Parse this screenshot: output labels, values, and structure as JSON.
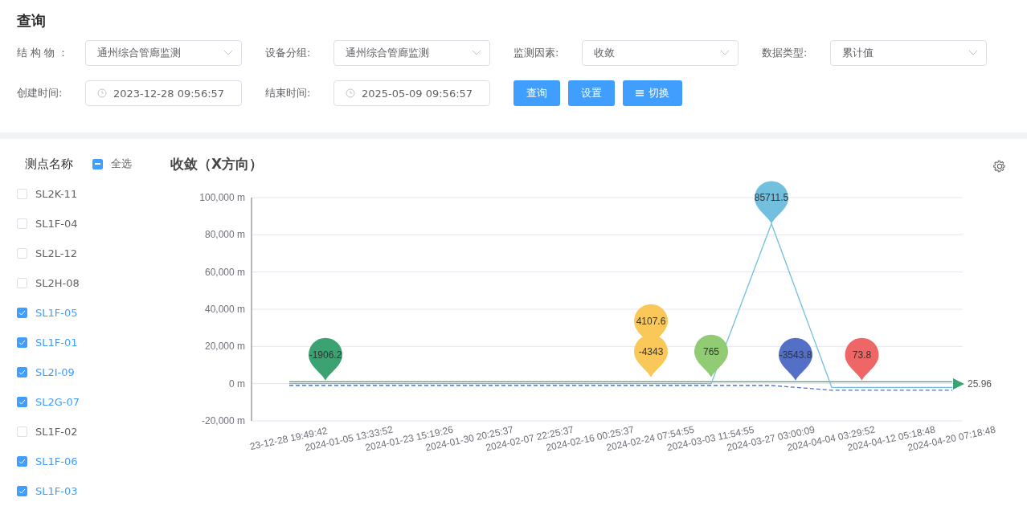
{
  "query_panel": {
    "title": "查询",
    "filters": [
      {
        "label": "结 构 物 ：",
        "kind": "select",
        "value": "通州综合管廊监测"
      },
      {
        "label": "设备分组:",
        "kind": "select",
        "value": "通州综合管廊监测"
      },
      {
        "label": "监测因素:",
        "kind": "select",
        "value": "收敛"
      },
      {
        "label": "数据类型:",
        "kind": "select",
        "value": "累计值"
      },
      {
        "label": "创建时间:",
        "kind": "date",
        "value": "2023-12-28 09:56:57"
      },
      {
        "label": "结束时间:",
        "kind": "date",
        "value": "2025-05-09 09:56:57"
      }
    ],
    "buttons": [
      {
        "label": "查询",
        "kind": "plain"
      },
      {
        "label": "设置",
        "kind": "plain"
      },
      {
        "label": "切换",
        "kind": "list"
      }
    ]
  },
  "point_list": {
    "title": "测点名称",
    "select_all": {
      "label": "全选",
      "indeterminate": true
    },
    "items": [
      {
        "name": "SL2K-11",
        "checked": false
      },
      {
        "name": "SL1F-04",
        "checked": false
      },
      {
        "name": "SL2L-12",
        "checked": false
      },
      {
        "name": "SL2H-08",
        "checked": false
      },
      {
        "name": "SL1F-05",
        "checked": true
      },
      {
        "name": "SL1F-01",
        "checked": true
      },
      {
        "name": "SL2I-09",
        "checked": true
      },
      {
        "name": "SL2G-07",
        "checked": true
      },
      {
        "name": "SL1F-02",
        "checked": false
      },
      {
        "name": "SL1F-06",
        "checked": true
      },
      {
        "name": "SL1F-03",
        "checked": true
      }
    ]
  },
  "chart": {
    "title": "收敛（X方向）",
    "chart_data": {
      "type": "line",
      "grid": true,
      "categories": [
        "23-12-28 19:49:42",
        "2024-01-05 13:33:52",
        "2024-01-23 15:19:26",
        "2024-01-30 20:25:37",
        "2024-02-07 22:25:37",
        "2024-02-16 00:25:37",
        "2024-02-24 07:54:55",
        "2024-03-03 11:54:55",
        "2024-03-27 03:00:09",
        "2024-04-04 03:29:52",
        "2024-04-12 05:18:48",
        "2024-04-20 07:18:48"
      ],
      "ylim": [
        -20000,
        100000
      ],
      "yticks": [
        {
          "value": -20000,
          "label": "-20,000 m"
        },
        {
          "value": 0,
          "label": "0 m"
        },
        {
          "value": 20000,
          "label": "20,000 m"
        },
        {
          "value": 40000,
          "label": "40,000 m"
        },
        {
          "value": 60000,
          "label": "60,000 m"
        },
        {
          "value": 80000,
          "label": "80,000 m"
        },
        {
          "value": 100000,
          "label": "100,000 m"
        }
      ],
      "series": [
        {
          "color": "#3ba272",
          "line_style": "solid",
          "values": [
            1000,
            1000,
            1000,
            1000,
            1000,
            1000,
            1000,
            1000,
            1000,
            1000,
            1000,
            1000
          ]
        },
        {
          "color": "#73c0de",
          "line_style": "solid",
          "values": [
            0,
            0,
            0,
            0,
            0,
            0,
            0,
            0,
            86000,
            -2000,
            -2000,
            -2000
          ]
        },
        {
          "color": "#5470c6",
          "line_style": "dashed",
          "values": [
            -1000,
            -1000,
            -1000,
            -1000,
            -1000,
            -1000,
            -1000,
            -1000,
            -1000,
            -3500,
            -3500,
            -3500
          ]
        }
      ]
    },
    "pins": [
      {
        "label": "-1906.2",
        "color": "#3ba272"
      },
      {
        "label": "4107.6",
        "color": "#fac858"
      },
      {
        "label": "-4343",
        "color": "#fac858"
      },
      {
        "label": "765",
        "color": "#91cc75"
      },
      {
        "label": "85711.5",
        "color": "#73c0de"
      },
      {
        "label": "-3543.8",
        "color": "#5470c6"
      },
      {
        "label": "73.8",
        "color": "#ee6666"
      }
    ],
    "end_label": "25.96"
  }
}
